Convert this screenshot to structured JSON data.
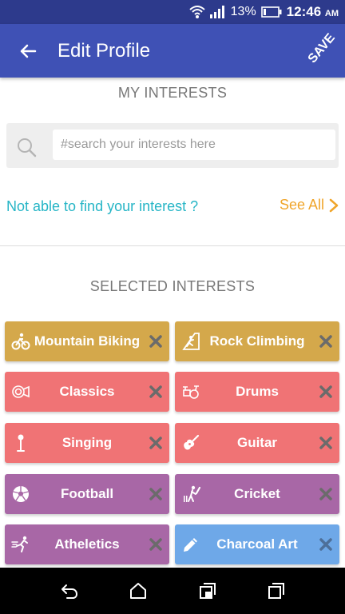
{
  "status": {
    "battery_percent": "13%",
    "time": "12:46",
    "ampm": "AM"
  },
  "appbar": {
    "title": "Edit Profile",
    "save_label": "SAVE"
  },
  "my_interests": {
    "heading": "MY INTERESTS",
    "search_placeholder": "#search your interests here",
    "not_found_text": "Not able to find your interest ?",
    "see_all_label": "See All"
  },
  "selected": {
    "heading": "SELECTED INTERESTS",
    "chips": [
      {
        "label": "Mountain Biking",
        "icon": "bicycle-icon",
        "color": "#d4a84b"
      },
      {
        "label": "Rock Climbing",
        "icon": "climber-icon",
        "color": "#d4a84b"
      },
      {
        "label": "Classics",
        "icon": "horn-icon",
        "color": "#f07375"
      },
      {
        "label": "Drums",
        "icon": "drum-icon",
        "color": "#f07375"
      },
      {
        "label": "Singing",
        "icon": "microphone-icon",
        "color": "#f07375"
      },
      {
        "label": "Guitar",
        "icon": "guitar-icon",
        "color": "#f07375"
      },
      {
        "label": "Football",
        "icon": "soccer-ball-icon",
        "color": "#a867a6"
      },
      {
        "label": "Cricket",
        "icon": "cricket-icon",
        "color": "#a867a6"
      },
      {
        "label": "Atheletics",
        "icon": "runner-icon",
        "color": "#a867a6"
      },
      {
        "label": "Charcoal Art",
        "icon": "pencil-icon",
        "color": "#6ea8e8"
      }
    ]
  },
  "colors": {
    "status_bar": "#2d3a8c",
    "app_bar": "#3f51b5",
    "link_teal": "#26b5c6",
    "link_orange": "#f0a52a"
  }
}
